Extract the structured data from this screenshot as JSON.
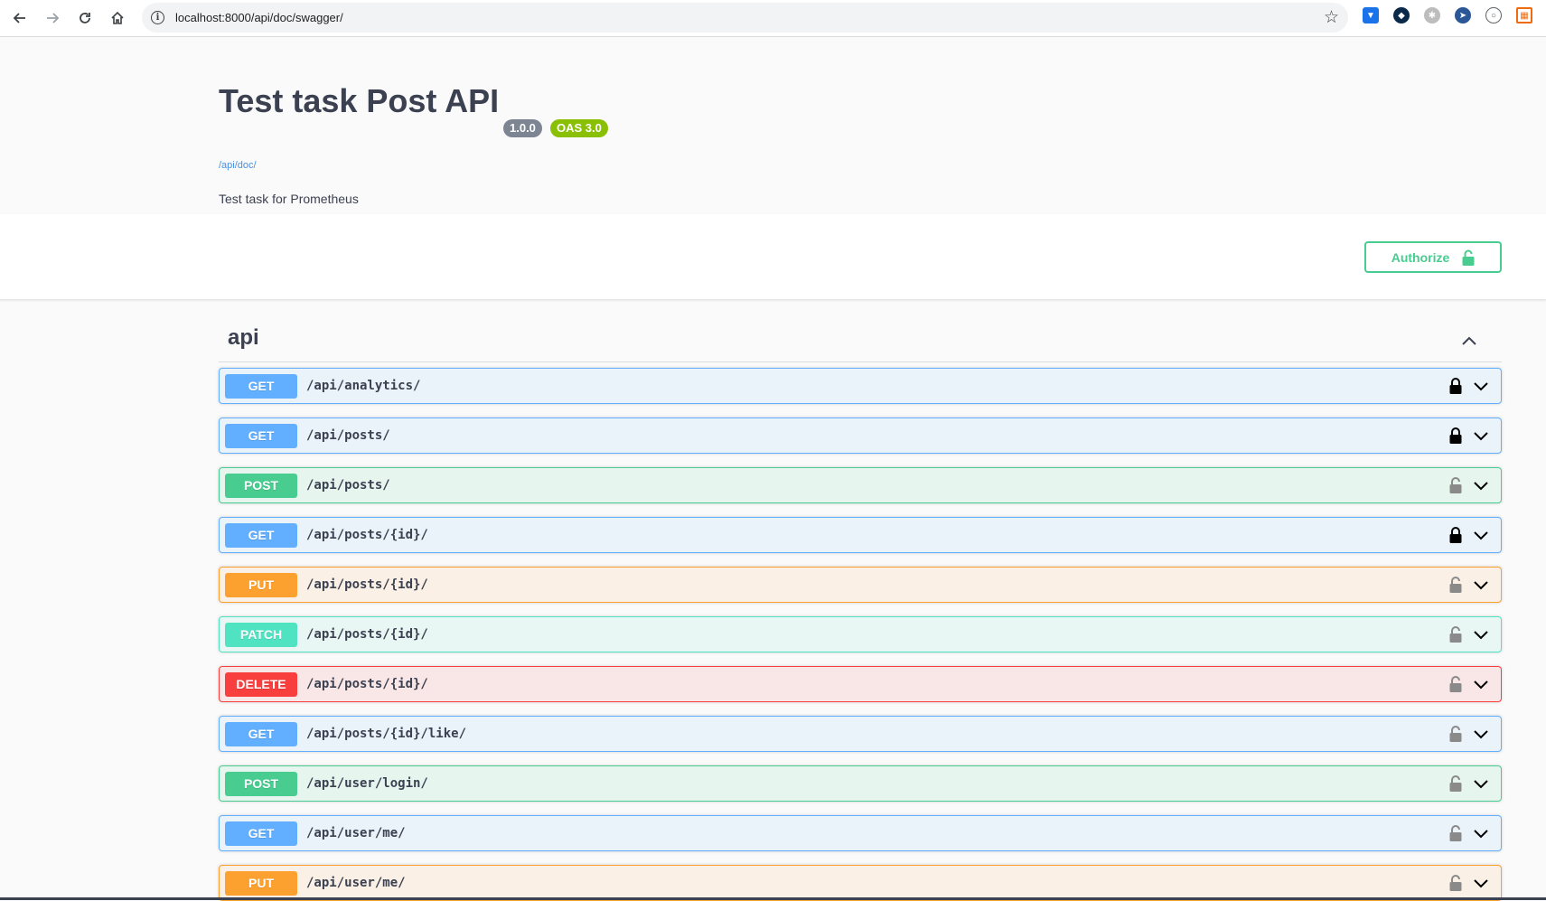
{
  "browser": {
    "url": "localhost:8000/api/doc/swagger/"
  },
  "info": {
    "title": "Test task Post API",
    "version": "1.0.0",
    "oas": "OAS 3.0",
    "base_url": "/api/doc/",
    "description": "Test task for Prometheus"
  },
  "scheme": {
    "authorize_label": "Authorize"
  },
  "tag": {
    "name": "api"
  },
  "operations": [
    {
      "method": "GET",
      "path": "/api/analytics/",
      "locked": true
    },
    {
      "method": "GET",
      "path": "/api/posts/",
      "locked": true
    },
    {
      "method": "POST",
      "path": "/api/posts/",
      "locked": false
    },
    {
      "method": "GET",
      "path": "/api/posts/{id}/",
      "locked": true
    },
    {
      "method": "PUT",
      "path": "/api/posts/{id}/",
      "locked": false
    },
    {
      "method": "PATCH",
      "path": "/api/posts/{id}/",
      "locked": false
    },
    {
      "method": "DELETE",
      "path": "/api/posts/{id}/",
      "locked": false
    },
    {
      "method": "GET",
      "path": "/api/posts/{id}/like/",
      "locked": false
    },
    {
      "method": "POST",
      "path": "/api/user/login/",
      "locked": false
    },
    {
      "method": "GET",
      "path": "/api/user/me/",
      "locked": false
    },
    {
      "method": "PUT",
      "path": "/api/user/me/",
      "locked": false
    }
  ],
  "colors": {
    "get": "#61affe",
    "post": "#49cc90",
    "put": "#fca130",
    "patch": "#50e3c2",
    "delete": "#f93e3e",
    "title": "#3b4151"
  }
}
